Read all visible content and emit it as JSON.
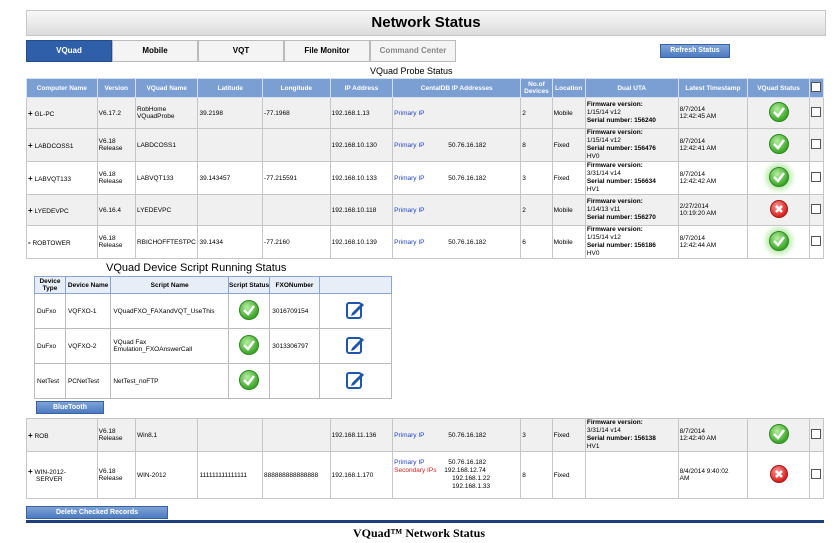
{
  "page_title": "Network Status",
  "tabs": [
    {
      "label": "VQuad",
      "active": true
    },
    {
      "label": "Mobile"
    },
    {
      "label": "VQT"
    },
    {
      "label": "File Monitor"
    },
    {
      "label": "Command Center",
      "disabled": true
    }
  ],
  "refresh_label": "Refresh Status",
  "probe_section_title": "VQuad Probe Status",
  "columns": [
    "Computer Name",
    "Version",
    "VQuad Name",
    "Latitude",
    "Longitude",
    "IP Address",
    "CentalDB IP Addresses",
    "No.of Devices",
    "Location",
    "Dual UTA",
    "Latest Timestamp",
    "VQuad Status"
  ],
  "rows_top": [
    {
      "expander": "+",
      "name": "GL-PC",
      "version": "V6.17.2",
      "vquad_name_1": "RobHome",
      "vquad_name_2": "VQuadProbe",
      "lat": "39.2198",
      "lon": "-77.1968",
      "ip": "192.168.1.13",
      "db_label": "Primary IP",
      "db_ip": "",
      "devices": "2",
      "location": "Mobile",
      "fw1": "Firmware version:",
      "fw2": "1/15/14 v12",
      "fw3": "Serial number: 156240",
      "fw4": "",
      "ts1": "8/7/2014",
      "ts2": "12:42:45 AM",
      "status": "ok"
    },
    {
      "expander": "+",
      "name": "LABDCOSS1",
      "version_1": "V6.18",
      "version_2": "Release",
      "vquad_name": "LABDCOSS1",
      "lat": "",
      "lon": "",
      "ip": "192.168.10.130",
      "db_label": "Primary IP",
      "db_ip": "50.76.16.182",
      "devices": "8",
      "location": "Fixed",
      "fw1": "Firmware version:",
      "fw2": "1/15/14 v12",
      "fw3": "Serial number: 156476",
      "fw4": "HV0",
      "ts1": "8/7/2014",
      "ts2": "12:42:41 AM",
      "status": "ok"
    },
    {
      "expander": "+",
      "name": "LABVQT133",
      "version_1": "V6.18",
      "version_2": "Release",
      "vquad_name": "LABVQT133",
      "lat": "39.143457",
      "lon": "-77.215591",
      "ip": "192.168.10.133",
      "db_label": "Primary IP",
      "db_ip": "50.76.16.182",
      "devices": "3",
      "location": "Fixed",
      "fw1": "Firmware version:",
      "fw2": "3/31/14 v14",
      "fw3": "Serial number: 156634",
      "fw4": "HV1",
      "ts1": "8/7/2014",
      "ts2": "12:42:42 AM",
      "status": "ok-glow"
    },
    {
      "expander": "+",
      "name": "LYEDEVPC",
      "version": "V6.16.4",
      "vquad_name": "LYEDEVPC",
      "lat": "",
      "lon": "",
      "ip": "192.168.10.118",
      "db_label": "Primary IP",
      "db_ip": "",
      "devices": "2",
      "location": "Mobile",
      "fw1": "Firmware version:",
      "fw2": "1/14/13 v11",
      "fw3": "Serial number: 156270",
      "fw4": "",
      "ts1": "2/27/2014",
      "ts2": "10:19:20 AM",
      "status": "err"
    },
    {
      "expander": "-",
      "name": "ROBTOWER",
      "version_1": "V6.18",
      "version_2": "Release",
      "vquad_name": "RBICHOFFTESTPC",
      "lat": "39.1434",
      "lon": "-77.2160",
      "ip": "192.168.10.139",
      "db_label": "Primary IP",
      "db_ip": "50.76.16.182",
      "devices": "6",
      "location": "Mobile",
      "fw1": "Firmware version:",
      "fw2": "1/15/14 v12",
      "fw3": "Serial number: 156186",
      "fw4": "HV0",
      "ts1": "8/7/2014",
      "ts2": "12:42:44 AM",
      "status": "ok-glow"
    }
  ],
  "script_section": {
    "title": "VQuad Device Script Running Status",
    "columns": [
      "Device Type",
      "Device Name",
      "Script Name",
      "Script Status",
      "FXONumber",
      ""
    ],
    "rows": [
      {
        "type": "DuFxo",
        "name": "VQFXO-1",
        "script_1": "VQuadFXO_FAXandVQT_UseThis",
        "script_2": "",
        "fxo": "3016709154"
      },
      {
        "type": "DuFxo",
        "name": "VQFXO-2",
        "script_1": "VQuad Fax",
        "script_2": "Emulation_FXOAnswerCall",
        "fxo": "3013306797"
      },
      {
        "type": "NetTest",
        "name": "PCNetTest",
        "script_1": "NetTest_noFTP",
        "script_2": "",
        "fxo": ""
      }
    ],
    "bluetooth_label": "BlueTooth"
  },
  "rows_bottom": [
    {
      "expander": "+",
      "name": "ROB",
      "version_1": "V6.18",
      "version_2": "Release",
      "vquad_name": "Win8.1",
      "lat": "",
      "lon": "",
      "ip": "192.168.11.136",
      "db_label": "Primary IP",
      "db_ip": "50.76.16.182",
      "devices": "3",
      "location": "Fixed",
      "fw1": "Firmware version:",
      "fw2": "3/31/14 v14",
      "fw3": "Serial number: 156138",
      "fw4": "HV1",
      "ts1": "8/7/2014",
      "ts2": "12:42:40 AM",
      "status": "ok"
    },
    {
      "expander": "+",
      "name_1": "WIN-2012-",
      "name_2": "SERVER",
      "version_1": "V6.18",
      "version_2": "Release",
      "vquad_name": "WIN-2012",
      "lat": "111111111111111",
      "lon": "888888888888888",
      "ip": "192.168.1.170",
      "db_label": "Primary IP",
      "db_ip": "50.76.16.182",
      "db_label2": "Secondary IPs",
      "db_ip2a": "192.168.12.74",
      "db_ip2b": "192.168.1.22",
      "db_ip2c": "192.168.1.33",
      "devices": "8",
      "location": "Fixed",
      "ts1": "8/4/2014 9:40:02",
      "ts2": "AM",
      "status": "err"
    }
  ],
  "delete_label": "Delete Checked Records",
  "footer": "VQuad™ Network Status"
}
